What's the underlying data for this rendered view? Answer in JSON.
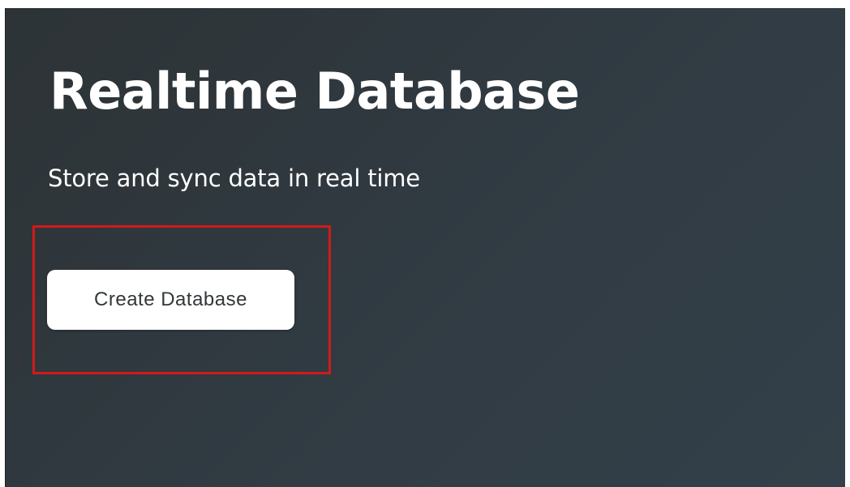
{
  "hero": {
    "title": "Realtime Database",
    "subtitle": "Store and sync data in real time",
    "create_button_label": "Create Database"
  },
  "colors": {
    "background": "#313c44",
    "text": "#ffffff",
    "button_bg": "#ffffff",
    "button_text": "#33373a",
    "highlight": "#d11a1a"
  }
}
